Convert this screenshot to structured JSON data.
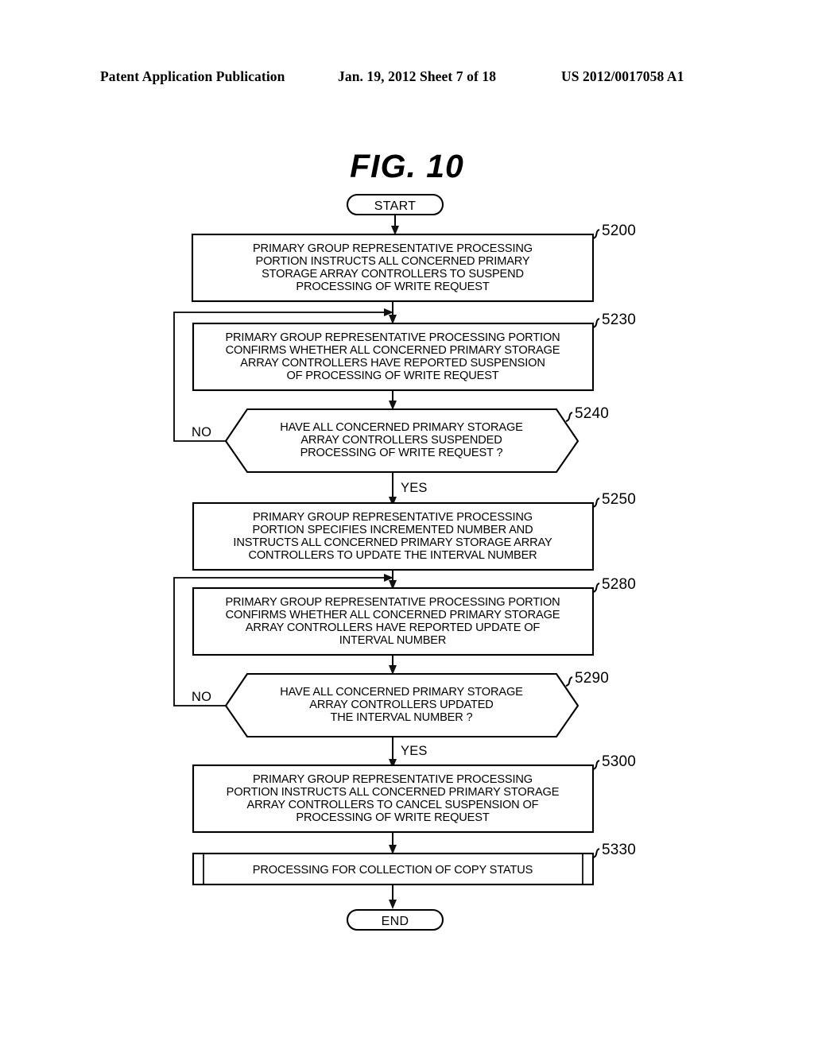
{
  "header": {
    "left": "Patent Application Publication",
    "middle": "Jan. 19, 2012  Sheet 7 of 18",
    "right": "US 2012/0017058 A1"
  },
  "figure": {
    "title": "FIG.  10"
  },
  "terminators": {
    "start": "START",
    "end": "END"
  },
  "branch_labels": {
    "no_1": "NO",
    "yes_1": "YES",
    "no_2": "NO",
    "yes_2": "YES"
  },
  "nodes": [
    {
      "id": "5200",
      "ref": "5200",
      "type": "process",
      "lines": [
        "PRIMARY GROUP REPRESENTATIVE PROCESSING",
        "PORTION INSTRUCTS ALL CONCERNED PRIMARY",
        "STORAGE ARRAY CONTROLLERS TO SUSPEND",
        "PROCESSING OF WRITE REQUEST"
      ]
    },
    {
      "id": "5230",
      "ref": "5230",
      "type": "process",
      "lines": [
        "PRIMARY GROUP REPRESENTATIVE PROCESSING PORTION",
        "CONFIRMS WHETHER ALL CONCERNED PRIMARY STORAGE",
        "ARRAY CONTROLLERS HAVE REPORTED SUSPENSION",
        "OF PROCESSING OF WRITE REQUEST"
      ]
    },
    {
      "id": "5240",
      "ref": "5240",
      "type": "decision",
      "lines": [
        "HAVE ALL CONCERNED PRIMARY STORAGE",
        "ARRAY CONTROLLERS SUSPENDED",
        "PROCESSING OF WRITE REQUEST ?"
      ]
    },
    {
      "id": "5250",
      "ref": "5250",
      "type": "process",
      "lines": [
        "PRIMARY GROUP REPRESENTATIVE PROCESSING",
        "PORTION SPECIFIES INCREMENTED NUMBER AND",
        "INSTRUCTS ALL CONCERNED PRIMARY STORAGE ARRAY",
        "CONTROLLERS TO UPDATE THE INTERVAL NUMBER"
      ]
    },
    {
      "id": "5280",
      "ref": "5280",
      "type": "process",
      "lines": [
        "PRIMARY GROUP REPRESENTATIVE PROCESSING PORTION",
        "CONFIRMS WHETHER ALL CONCERNED PRIMARY STORAGE",
        "ARRAY CONTROLLERS HAVE REPORTED UPDATE OF",
        "INTERVAL NUMBER"
      ]
    },
    {
      "id": "5290",
      "ref": "5290",
      "type": "decision",
      "lines": [
        "HAVE ALL CONCERNED PRIMARY STORAGE",
        "ARRAY CONTROLLERS UPDATED",
        "THE INTERVAL NUMBER ?"
      ]
    },
    {
      "id": "5300",
      "ref": "5300",
      "type": "process",
      "lines": [
        "PRIMARY GROUP REPRESENTATIVE PROCESSING",
        "PORTION INSTRUCTS ALL CONCERNED PRIMARY STORAGE",
        "ARRAY CONTROLLERS TO CANCEL SUSPENSION OF",
        "PROCESSING OF WRITE REQUEST"
      ]
    },
    {
      "id": "5330",
      "ref": "5330",
      "type": "predefined-process",
      "lines": [
        "PROCESSING FOR COLLECTION OF COPY STATUS"
      ]
    }
  ],
  "colors": {
    "ink": "#000000",
    "paper": "#ffffff"
  }
}
